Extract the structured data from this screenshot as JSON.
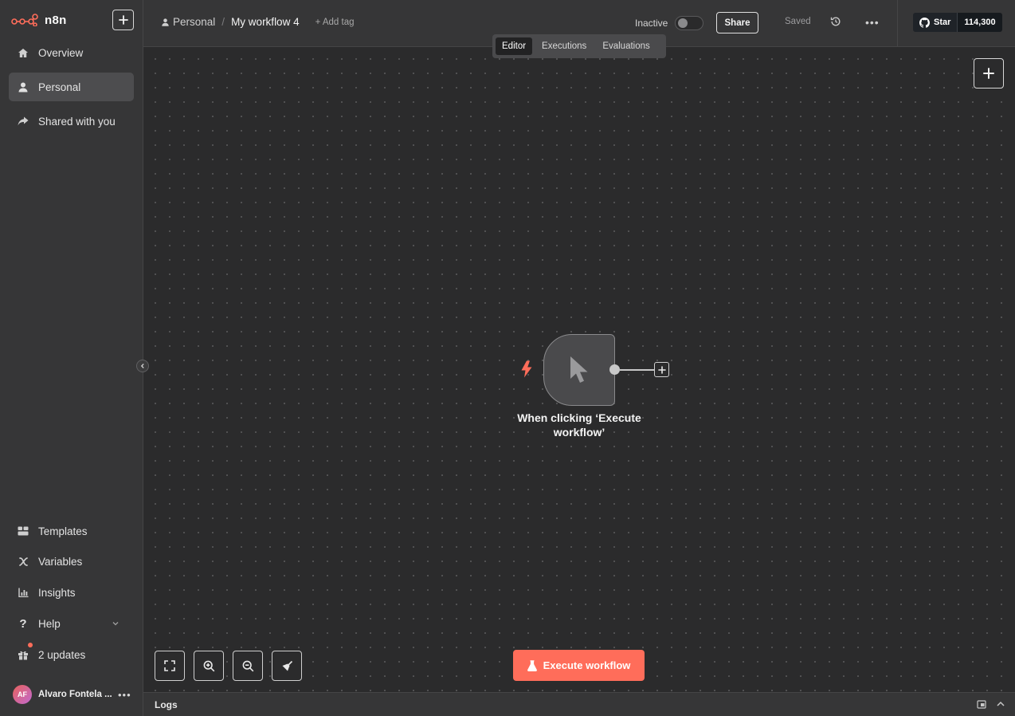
{
  "app": {
    "name": "n8n",
    "accent_color": "#ff6d5a"
  },
  "sidebar": {
    "new_icon": "plus-icon",
    "top_items": [
      {
        "label": "Overview",
        "icon": "home-icon"
      },
      {
        "label": "Personal",
        "icon": "user-icon",
        "active": true
      },
      {
        "label": "Shared with you",
        "icon": "share-icon"
      }
    ],
    "bottom_items": [
      {
        "label": "Templates",
        "icon": "templates-icon"
      },
      {
        "label": "Variables",
        "icon": "variables-icon"
      },
      {
        "label": "Insights",
        "icon": "chart-icon"
      },
      {
        "label": "Help",
        "icon": "help-icon"
      },
      {
        "label": "2 updates",
        "icon": "gift-icon"
      }
    ],
    "user": {
      "initials": "AF",
      "name": "Alvaro Fontela ..."
    }
  },
  "header": {
    "project": "Personal",
    "separator": "/",
    "workflow_title": "My workflow 4",
    "add_tag": "+ Add tag",
    "active_label": "Inactive",
    "share_label": "Share",
    "saved_label": "Saved",
    "github": {
      "label": "Star",
      "count": "114,300"
    }
  },
  "tabs": [
    {
      "label": "Editor",
      "active": true
    },
    {
      "label": "Executions",
      "active": false
    },
    {
      "label": "Evaluations",
      "active": false
    }
  ],
  "canvas": {
    "node": {
      "label": "When clicking ‘Execute workflow’",
      "icon": "cursor-icon"
    },
    "execute_label": "Execute workflow"
  },
  "logs": {
    "title": "Logs"
  }
}
